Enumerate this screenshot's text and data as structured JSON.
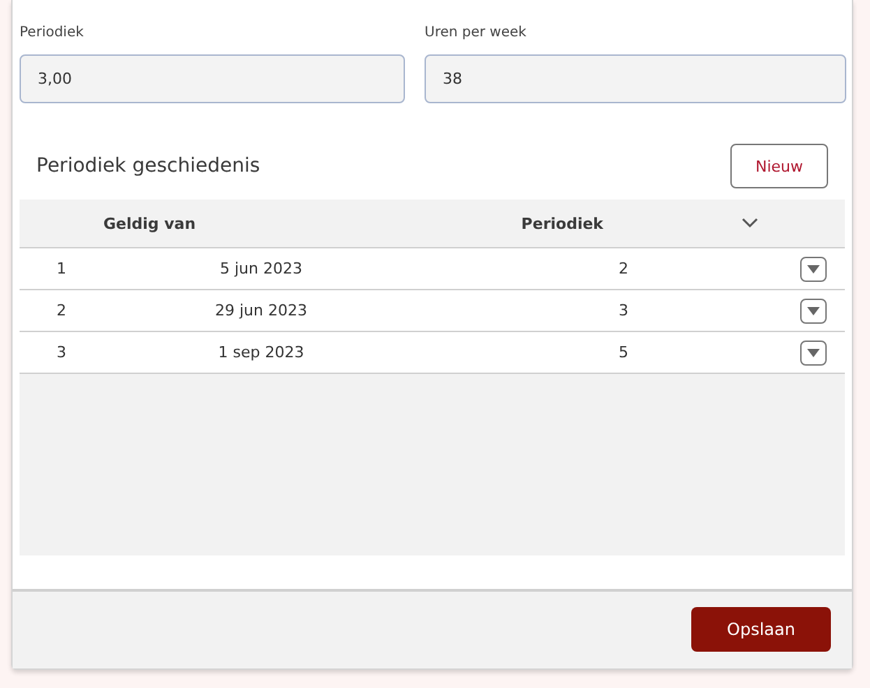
{
  "fields": [
    {
      "label": "Periodiek",
      "value": "3,00"
    },
    {
      "label": "Uren per week",
      "value": "38"
    }
  ],
  "history": {
    "title": "Periodiek geschiedenis",
    "new_button": "Nieuw",
    "columns": [
      "Geldig van",
      "Periodiek"
    ],
    "rows": [
      {
        "index": "1",
        "date": "5 jun 2023",
        "periodiek": "2"
      },
      {
        "index": "2",
        "date": "29 jun 2023",
        "periodiek": "3"
      },
      {
        "index": "3",
        "date": "1 sep 2023",
        "periodiek": "5"
      }
    ]
  },
  "footer": {
    "save_button": "Opslaan"
  }
}
